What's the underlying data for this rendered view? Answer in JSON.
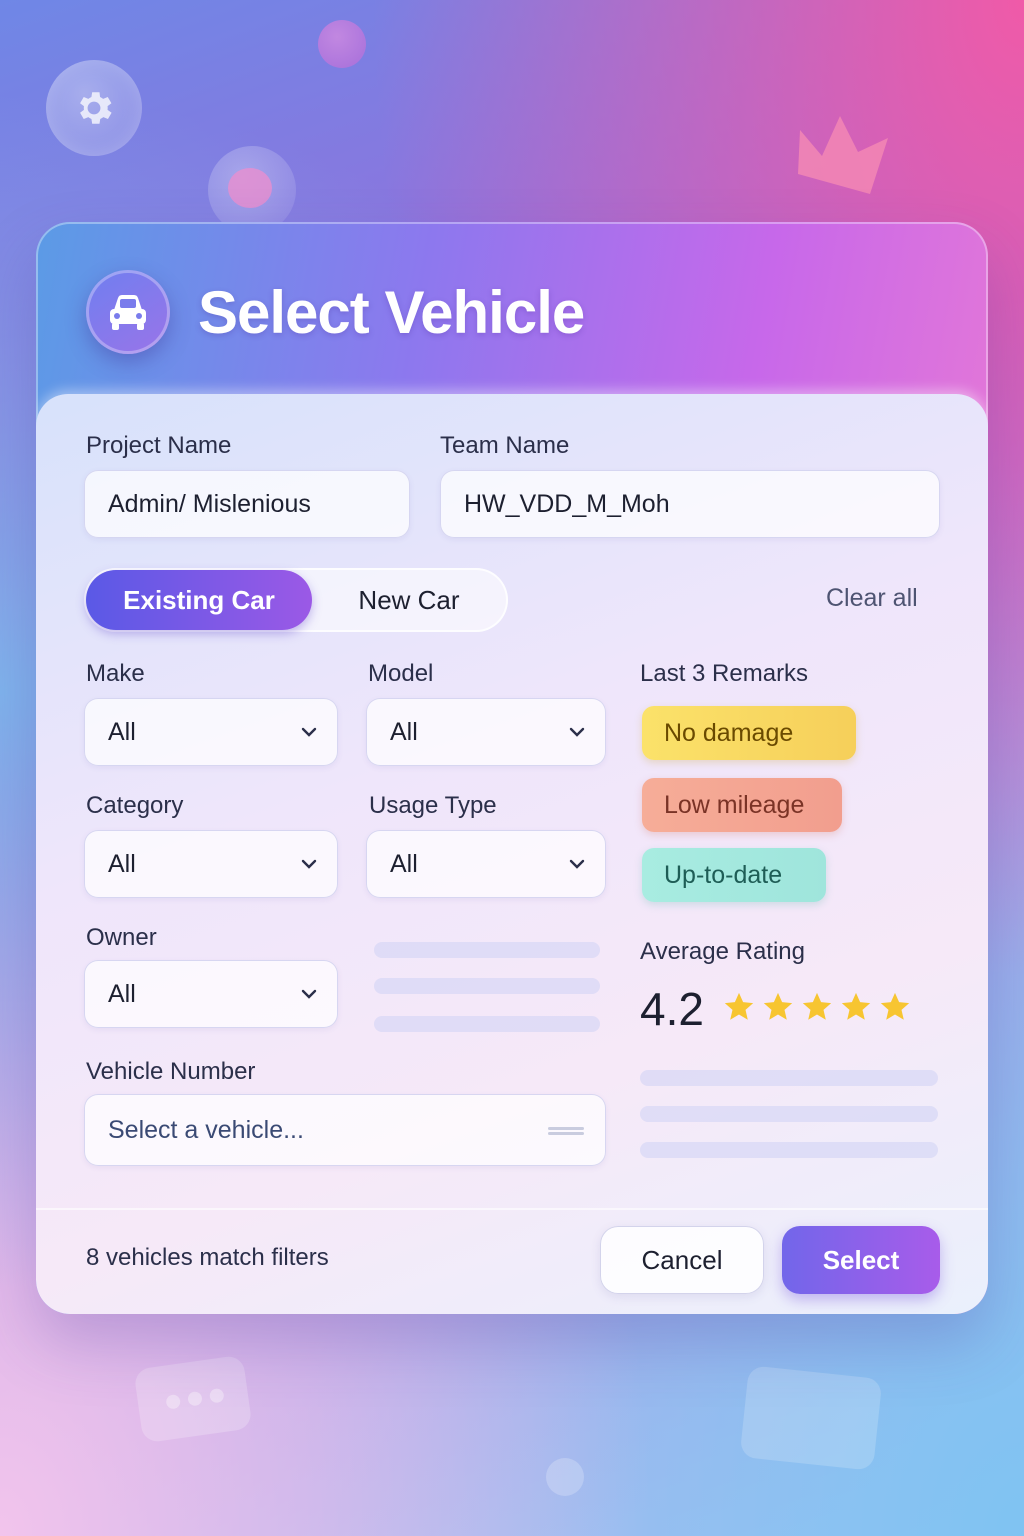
{
  "dialog": {
    "title": "Select Vehicle",
    "header_icon": "car-icon"
  },
  "form": {
    "project_name": {
      "label": "Project Name",
      "value": "Admin/ Mislenious"
    },
    "team_name": {
      "label": "Team Name",
      "value": "HW_VDD_M_Moh"
    },
    "toggle": {
      "active": "Existing Car",
      "inactive": "New Car"
    },
    "clear_all": "Clear all",
    "make": {
      "label": "Make",
      "value": "All"
    },
    "model": {
      "label": "Model",
      "value": "All"
    },
    "category": {
      "label": "Category",
      "value": "All"
    },
    "usage_type": {
      "label": "Usage Type",
      "value": "All"
    },
    "owner": {
      "label": "Owner",
      "value": "All"
    },
    "vehicle_number": {
      "label": "Vehicle Number",
      "placeholder": "Select a vehicle..."
    }
  },
  "remarks": {
    "label": "Last 3 Remarks",
    "items": [
      "No damage",
      "Low mileage",
      "Up-to-date"
    ],
    "colors": [
      "#f8d860",
      "#f4a894",
      "#a4e9df"
    ]
  },
  "rating": {
    "label": "Average Rating",
    "value": "4.2",
    "stars": 5,
    "star_color": "#f7c531"
  },
  "footer": {
    "match_text": "8 vehicles match filters",
    "cancel_label": "Cancel",
    "select_label": "Select"
  },
  "colors": {
    "accent": "#6a5be6",
    "accent_end": "#a85cea"
  }
}
